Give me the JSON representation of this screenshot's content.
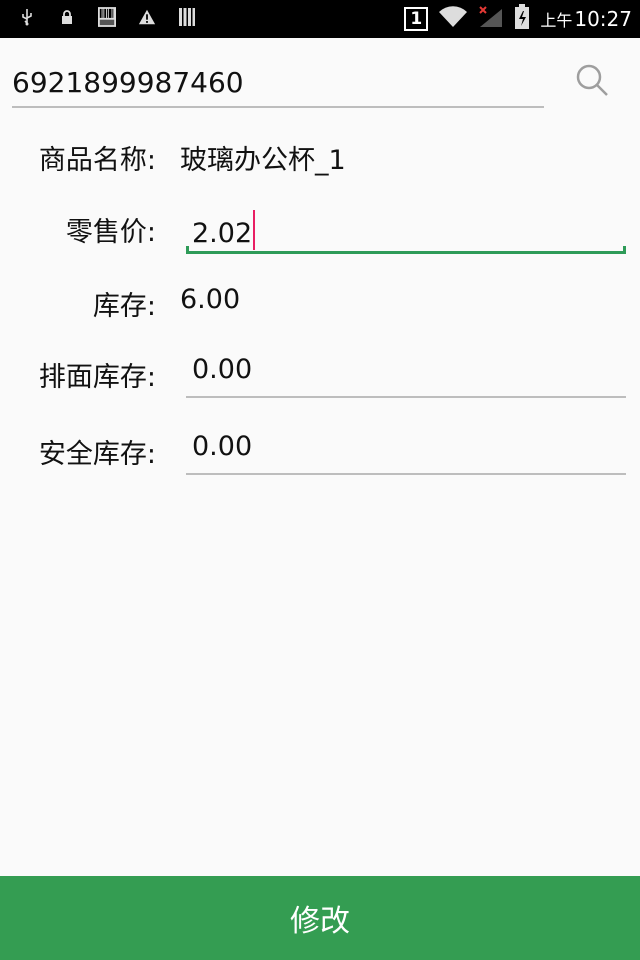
{
  "status_bar": {
    "icons_left": [
      "usb-icon",
      "lock-icon",
      "barcode-icon",
      "warning-icon",
      "sim-bars-icon"
    ],
    "sim_slot": "1",
    "time_prefix": "上午",
    "time": "10:27"
  },
  "search": {
    "value": "6921899987460",
    "icon": "search-icon"
  },
  "form": {
    "name_label": "商品名称:",
    "name_value": "玻璃办公杯_1",
    "price_label": "零售价:",
    "price_value": "2.02",
    "stock_label": "库存:",
    "stock_value": "6.00",
    "shelf_stock_label": "排面库存:",
    "shelf_stock_value": "0.00",
    "safety_stock_label": "安全库存:",
    "safety_stock_value": "0.00"
  },
  "colors": {
    "accent": "#2e9b58",
    "button_bg": "#349d52",
    "cursor": "#e91e63"
  },
  "actions": {
    "modify_label": "修改"
  }
}
